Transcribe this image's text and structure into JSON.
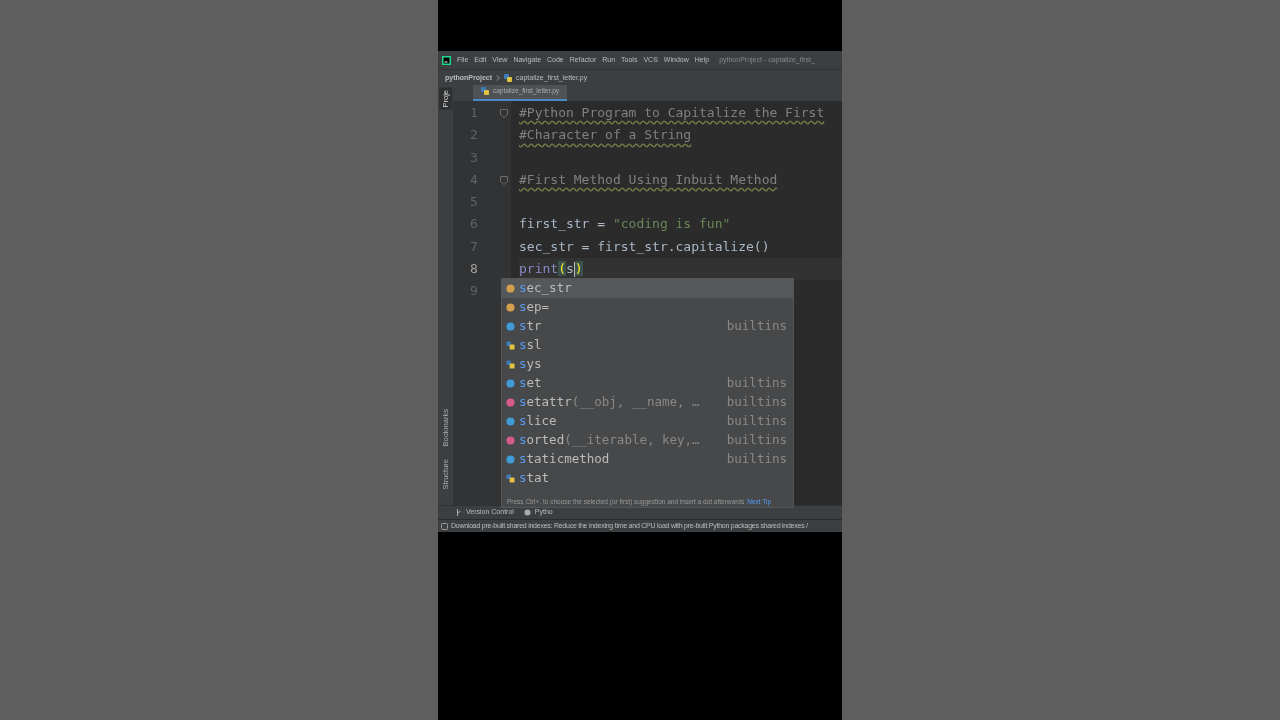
{
  "menu_bar": {
    "items": [
      "File",
      "Edit",
      "View",
      "Navigate",
      "Code",
      "Refactor",
      "Run",
      "Tools",
      "VCS",
      "Window",
      "Help"
    ],
    "title": "pythonProject - captalize_first_"
  },
  "breadcrumb": [
    "pythonProject",
    "captalize_first_letter.py"
  ],
  "editor_tabs": [
    {
      "label": "captalize_first_letter.py",
      "selected": true
    }
  ],
  "left_tool_windows_top": [
    {
      "label": "Proje",
      "selected": true
    }
  ],
  "left_tool_windows_bottom": [
    {
      "label": "Bookmarks",
      "selected": false
    },
    {
      "label": "Structure",
      "selected": false
    }
  ],
  "code_lines": [
    {
      "number": "1",
      "current": false,
      "fold": true,
      "segments": [
        {
          "text": "#Python Program to Capitalize the First",
          "kind": "comment"
        }
      ]
    },
    {
      "number": "2",
      "current": false,
      "fold": false,
      "segments": [
        {
          "text": "#Character of a String",
          "kind": "comment"
        }
      ]
    },
    {
      "number": "3",
      "current": false,
      "fold": false
    },
    {
      "number": "4",
      "current": false,
      "fold": true,
      "segments": [
        {
          "text": "#First Method Using Inbuit Method",
          "kind": "comment"
        }
      ]
    },
    {
      "number": "5",
      "current": false,
      "fold": false
    },
    {
      "number": "6",
      "current": false,
      "fold": false,
      "segments": [
        {
          "text": "first_str = ",
          "kind": "plain"
        },
        {
          "text": "\"coding is fun\"",
          "kind": "string"
        }
      ]
    },
    {
      "number": "7",
      "current": false,
      "fold": false,
      "segments": [
        {
          "text": "sec_str = first_str.capitalize()",
          "kind": "plain"
        }
      ]
    },
    {
      "number": "8",
      "current": true,
      "fold": false,
      "segments": [
        {
          "text": "print",
          "kind": "builtin"
        },
        {
          "text": "(",
          "kind": "brace"
        },
        {
          "text": "s",
          "kind": "plain",
          "caret": true
        },
        {
          "text": ")",
          "kind": "brace"
        }
      ]
    },
    {
      "number": "9",
      "current": false,
      "fold": false
    }
  ],
  "completion": {
    "items": [
      {
        "kind": "variable",
        "match": "s",
        "rest": "ec_str",
        "selected": true
      },
      {
        "kind": "parameter",
        "match": "s",
        "rest": "ep=",
        "selected": false
      },
      {
        "kind": "class",
        "match": "s",
        "rest": "tr",
        "source": "builtins",
        "selected": false
      },
      {
        "kind": "module",
        "match": "s",
        "rest": "sl",
        "selected": false
      },
      {
        "kind": "module",
        "match": "s",
        "rest": "ys",
        "selected": false
      },
      {
        "kind": "class",
        "match": "s",
        "rest": "et",
        "source": "builtins",
        "selected": false
      },
      {
        "kind": "function",
        "match": "s",
        "rest": "etattr",
        "args": "(__obj, __name, …",
        "source": "builtins",
        "selected": false
      },
      {
        "kind": "class",
        "match": "s",
        "rest": "lice",
        "source": "builtins",
        "selected": false
      },
      {
        "kind": "function",
        "match": "s",
        "rest": "orted",
        "args": "(__iterable, key,…",
        "source": "builtins",
        "selected": false
      },
      {
        "kind": "class",
        "match": "s",
        "rest": "taticmethod",
        "source": "builtins",
        "selected": false
      },
      {
        "kind": "module",
        "match": "s",
        "rest": "tat",
        "selected": false
      }
    ],
    "hint": "Press Ctrl+. to choose the selected (or first) suggestion and insert a dot afterwards",
    "next_tip": "Next Tip"
  },
  "bottom_tool_windows": [
    {
      "label": "Version Control"
    },
    {
      "label": "Pytho"
    }
  ],
  "status_bar": "Download pre-built shared indexes: Reduce the indexing time and CPU load with pre-built Python packages shared indexes /"
}
